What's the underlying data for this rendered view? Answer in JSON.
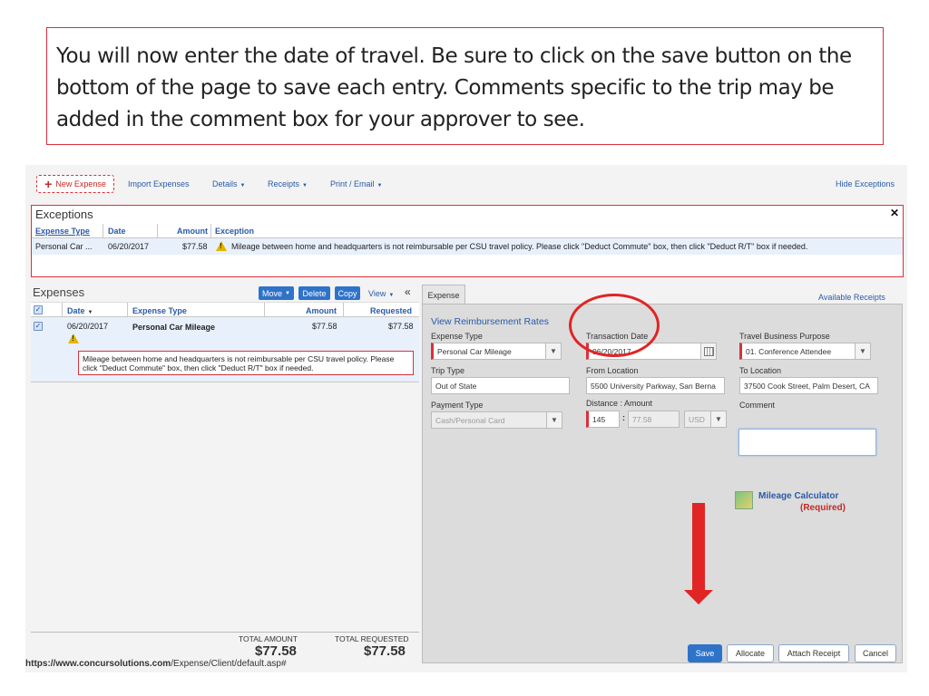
{
  "instruction": {
    "text": "You will now enter the date of travel. Be sure to click on the save button on the bottom of the page to save each entry.  Comments specific to the trip may be added in the comment box for your approver to see."
  },
  "toolbar": {
    "new_expense": "New Expense",
    "import_expenses": "Import Expenses",
    "details": "Details",
    "receipts": "Receipts",
    "print_email": "Print / Email",
    "hide_exceptions": "Hide Exceptions"
  },
  "exceptions": {
    "title": "Exceptions",
    "columns": [
      "Expense Type",
      "Date",
      "Amount",
      "Exception"
    ],
    "rows": [
      {
        "expense_type": "Personal Car ...",
        "date": "06/20/2017",
        "amount": "$77.58",
        "exception": "Mileage between home and headquarters is not reimbursable per CSU travel policy. Please click \"Deduct Commute\" box, then click \"Deduct R/T\" box if needed."
      }
    ]
  },
  "expenses": {
    "title": "Expenses",
    "buttons": {
      "move": "Move",
      "delete": "Delete",
      "copy": "Copy",
      "view": "View"
    },
    "columns": [
      "Date",
      "Expense Type",
      "Amount",
      "Requested"
    ],
    "rows": [
      {
        "date": "06/20/2017",
        "expense_type": "Personal Car Mileage",
        "amount": "$77.58",
        "requested": "$77.58",
        "message": "Mileage between home and headquarters is not reimbursable per CSU travel policy. Please click \"Deduct Commute\" box, then click \"Deduct R/T\" box if needed."
      }
    ],
    "total_amount_label": "TOTAL AMOUNT",
    "total_amount": "$77.58",
    "total_requested_label": "TOTAL REQUESTED",
    "total_requested": "$77.58"
  },
  "form": {
    "tab": "Expense",
    "available_receipts": "Available Receipts",
    "view_rates": "View Reimbursement Rates",
    "expense_type_label": "Expense Type",
    "expense_type": "Personal Car Mileage",
    "transaction_date_label": "Transaction Date",
    "transaction_date": "06/20/2017",
    "purpose_label": "Travel Business Purpose",
    "purpose": "01. Conference Attendee",
    "trip_type_label": "Trip Type",
    "trip_type": "Out of State",
    "from_label": "From Location",
    "from": "5500 University Parkway, San Berna",
    "to_label": "To Location",
    "to": "37500 Cook Street, Palm Desert, CA",
    "payment_label": "Payment Type",
    "payment": "Cash/Personal Card",
    "distance_label": "Distance : Amount",
    "distance": "145",
    "amount": "77.58",
    "currency": "USD",
    "comment_label": "Comment",
    "comment": "",
    "mileage_calc": "Mileage Calculator",
    "required": "(Required)",
    "buttons": {
      "save": "Save",
      "allocate": "Allocate",
      "attach_receipt": "Attach Receipt",
      "cancel": "Cancel"
    }
  },
  "status_url": {
    "host": "https://www.concursolutions.com",
    "path": "/Expense/Client/default.asp#"
  },
  "colors": {
    "accent": "#2f73c9",
    "alert": "#d9313a",
    "annotation": "#e12424"
  }
}
